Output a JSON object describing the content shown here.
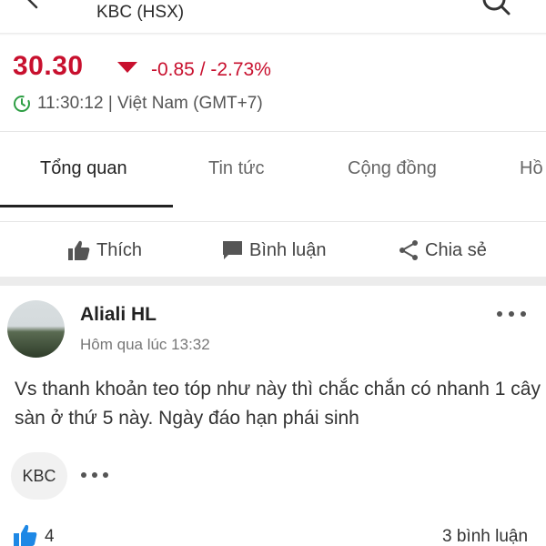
{
  "header": {
    "title": "KBC (HSX)"
  },
  "quote": {
    "price": "30.30",
    "change": "-0.85 / -2.73%",
    "time": "11:30:12 | Việt Nam (GMT+7)",
    "color_down": "#c8102e",
    "color_clock": "#2e9e44"
  },
  "tabs": [
    {
      "label": "Tổng quan",
      "active": true
    },
    {
      "label": "Tin tức"
    },
    {
      "label": "Cộng đồng"
    },
    {
      "label": "Hồ"
    }
  ],
  "actions": {
    "like": "Thích",
    "comment": "Bình luận",
    "share": "Chia sẻ"
  },
  "post": {
    "author": "Aliali HL",
    "time": "Hôm qua lúc 13:32",
    "body": "Vs thanh khoản teo tóp như này thì chắc chắn có nhanh 1 cây sàn ở thứ 5 này. Ngày đáo hạn phái sinh",
    "tag": "KBC",
    "likes": "4",
    "comments": "3 bình luận",
    "like_color": "#1e88e5"
  },
  "icons": [
    "back-arrow-icon",
    "search-icon",
    "down-arrow-icon",
    "clock-icon",
    "thumbs-up-icon",
    "comment-icon",
    "share-icon",
    "more-icon"
  ]
}
